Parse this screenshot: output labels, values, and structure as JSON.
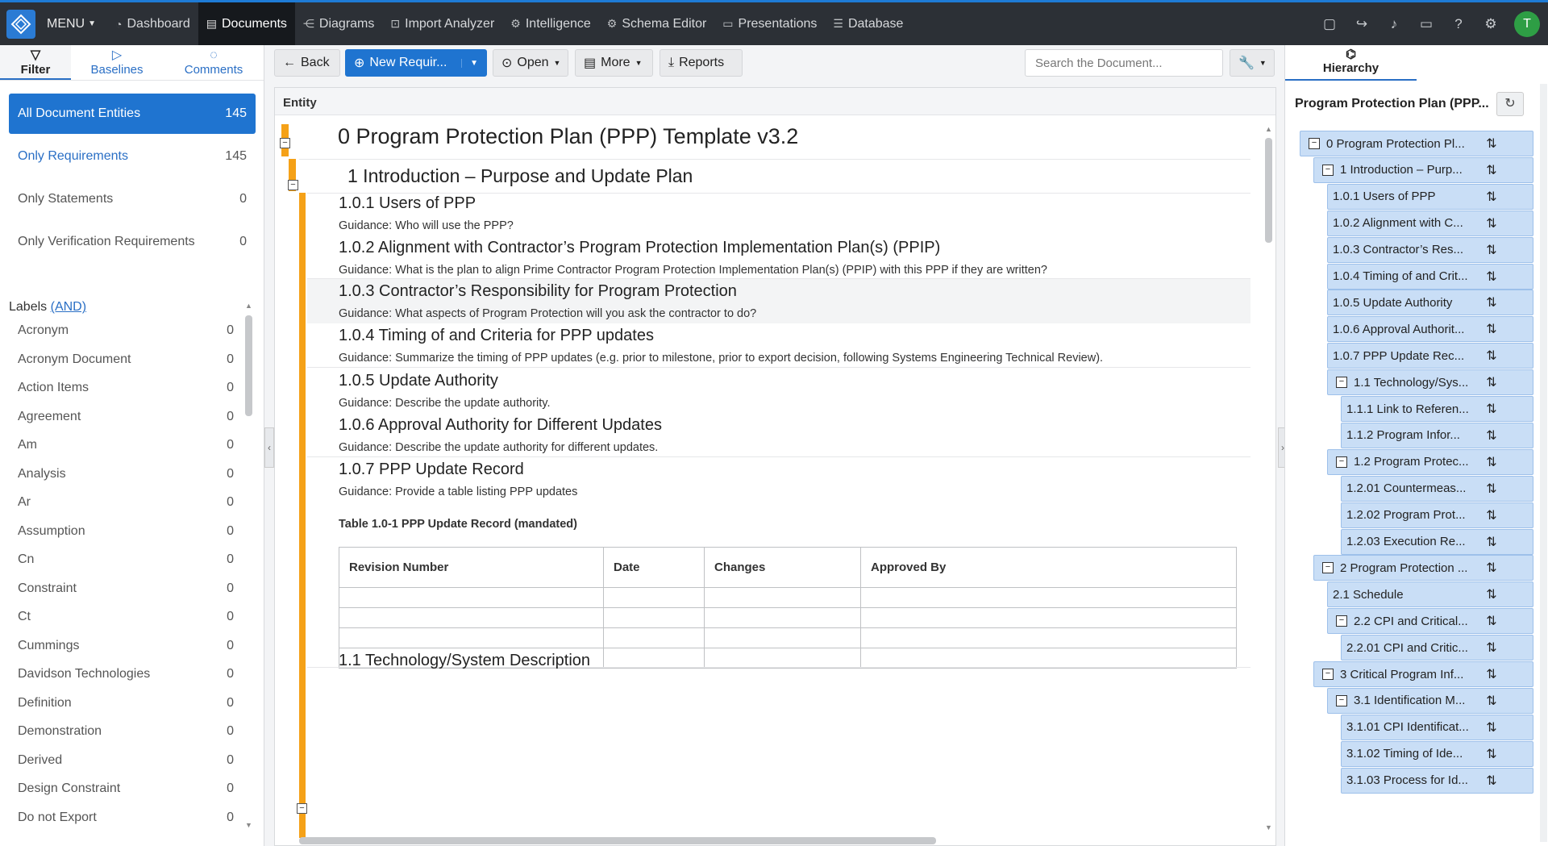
{
  "nav": {
    "menu": "MENU",
    "items": [
      "Dashboard",
      "Documents",
      "Diagrams",
      "Import Analyzer",
      "Intelligence",
      "Schema Editor",
      "Presentations",
      "Database"
    ],
    "avatar": "T"
  },
  "left": {
    "tabs": [
      "Filter",
      "Baselines",
      "Comments"
    ],
    "entities": [
      {
        "label": "All Document Entities",
        "count": "145"
      },
      {
        "label": "Only Requirements",
        "count": "145"
      },
      {
        "label": "Only Statements",
        "count": "0"
      },
      {
        "label": "Only Verification Requirements",
        "count": "0"
      }
    ],
    "labels_title": "Labels",
    "labels_mode": "(AND)",
    "labels": [
      {
        "name": "Acronym",
        "count": "0"
      },
      {
        "name": "Acronym Document",
        "count": "0"
      },
      {
        "name": "Action Items",
        "count": "0"
      },
      {
        "name": "Agreement",
        "count": "0"
      },
      {
        "name": "Am",
        "count": "0"
      },
      {
        "name": "Analysis",
        "count": "0"
      },
      {
        "name": "Ar",
        "count": "0"
      },
      {
        "name": "Assumption",
        "count": "0"
      },
      {
        "name": "Cn",
        "count": "0"
      },
      {
        "name": "Constraint",
        "count": "0"
      },
      {
        "name": "Ct",
        "count": "0"
      },
      {
        "name": "Cummings",
        "count": "0"
      },
      {
        "name": "Davidson Technologies",
        "count": "0"
      },
      {
        "name": "Definition",
        "count": "0"
      },
      {
        "name": "Demonstration",
        "count": "0"
      },
      {
        "name": "Derived",
        "count": "0"
      },
      {
        "name": "Design Constraint",
        "count": "0"
      },
      {
        "name": "Do not Export",
        "count": "0"
      }
    ]
  },
  "toolbar": {
    "back": "Back",
    "new_req": "New Requir...",
    "open": "Open",
    "more": "More",
    "reports": "Reports",
    "search_placeholder": "Search the Document..."
  },
  "doc": {
    "column_header": "Entity",
    "h0": "0 Program Protection Plan (PPP) Template v3.2",
    "h1": "1 Introduction – Purpose and Update Plan",
    "sections": [
      {
        "title": "1.0.1 Users of PPP",
        "guidance": "Guidance: Who will use the PPP?"
      },
      {
        "title": "1.0.2 Alignment with Contractor’s Program Protection Implementation Plan(s) (PPIP)",
        "guidance": "Guidance: What is the plan to align Prime Contractor Program Protection Implementation Plan(s) (PPIP) with this PPP if they are written?"
      },
      {
        "title": "1.0.3 Contractor’s Responsibility for Program Protection",
        "guidance": "Guidance: What aspects of Program Protection will you ask the contractor to do?"
      },
      {
        "title": "1.0.4 Timing of and Criteria for PPP updates",
        "guidance": "Guidance:  Summarize the timing of PPP updates (e.g. prior to milestone, prior to export decision, following Systems Engineering Technical Review)."
      },
      {
        "title": "1.0.5 Update Authority",
        "guidance": "Guidance:  Describe the update authority."
      },
      {
        "title": "1.0.6 Approval Authority for Different Updates",
        "guidance": "Guidance:  Describe the update authority for different updates."
      },
      {
        "title": "1.0.7 PPP Update Record",
        "guidance": "Guidance:  Provide a table listing PPP updates"
      }
    ],
    "table_caption": "Table 1.0-1 PPP Update Record (mandated)",
    "table_headers": [
      "Revision Number",
      "Date",
      "Changes",
      "Approved By"
    ],
    "next_heading": "1.1 Technology/System Description"
  },
  "hierarchy": {
    "tab": "Hierarchy",
    "title": "Program Protection Plan (PPP...",
    "nodes": [
      {
        "label": "0 Program Protection Pl...",
        "collapsible": true
      },
      {
        "label": "1 Introduction – Purp...",
        "collapsible": true
      },
      {
        "label": "1.0.1 Users of PPP",
        "collapsible": false
      },
      {
        "label": "1.0.2 Alignment with C...",
        "collapsible": false
      },
      {
        "label": "1.0.3 Contractor’s Res...",
        "collapsible": false
      },
      {
        "label": "1.0.4 Timing of and Crit...",
        "collapsible": false
      },
      {
        "label": "1.0.5 Update Authority",
        "collapsible": false
      },
      {
        "label": "1.0.6 Approval Authorit...",
        "collapsible": false
      },
      {
        "label": "1.0.7 PPP Update Rec...",
        "collapsible": false
      },
      {
        "label": "1.1 Technology/Sys...",
        "collapsible": true
      },
      {
        "label": "1.1.1 Link to Referen...",
        "collapsible": false
      },
      {
        "label": "1.1.2 Program Infor...",
        "collapsible": false
      },
      {
        "label": "1.2 Program Protec...",
        "collapsible": true
      },
      {
        "label": "1.2.01 Countermeas...",
        "collapsible": false
      },
      {
        "label": "1.2.02 Program Prot...",
        "collapsible": false
      },
      {
        "label": "1.2.03 Execution Re...",
        "collapsible": false
      },
      {
        "label": "2 Program Protection ...",
        "collapsible": true
      },
      {
        "label": "2.1 Schedule",
        "collapsible": false
      },
      {
        "label": "2.2 CPI and Critical...",
        "collapsible": true
      },
      {
        "label": "2.2.01 CPI and Critic...",
        "collapsible": false
      },
      {
        "label": "3 Critical Program Inf...",
        "collapsible": true
      },
      {
        "label": "3.1 Identification M...",
        "collapsible": true
      },
      {
        "label": "3.1.01 CPI Identificat...",
        "collapsible": false
      },
      {
        "label": "3.1.02 Timing of Ide...",
        "collapsible": false
      },
      {
        "label": "3.1.03 Process for Id...",
        "collapsible": false
      }
    ]
  }
}
